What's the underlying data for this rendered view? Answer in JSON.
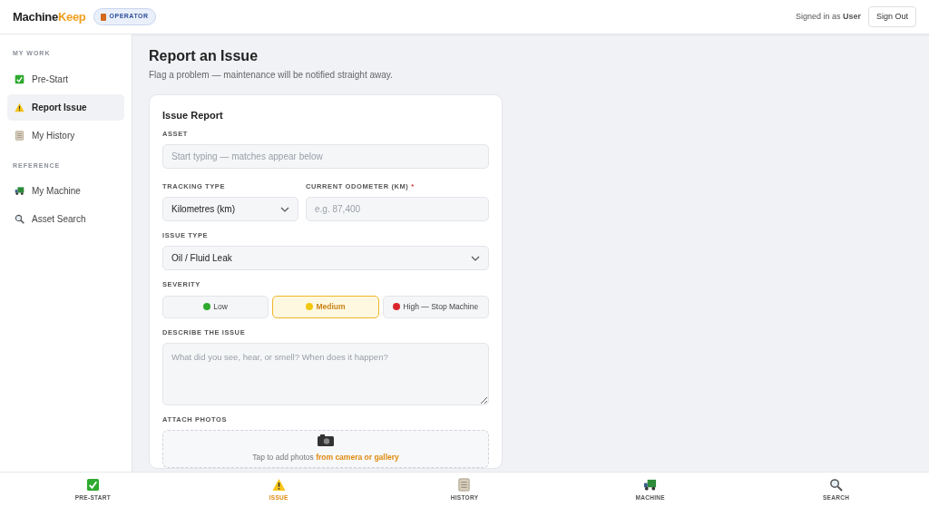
{
  "brand": {
    "part_1": "Machine",
    "part_2": "Keep"
  },
  "role_badge": "OPERATOR",
  "header": {
    "signed_in_prefix": "Signed in as",
    "user": "User",
    "sign_out": "Sign Out"
  },
  "sidebar": {
    "sections": [
      {
        "title": "MY WORK",
        "items": [
          {
            "label": "Pre-Start",
            "selected": false
          },
          {
            "label": "Report Issue",
            "selected": true
          },
          {
            "label": "My History",
            "selected": false
          }
        ]
      },
      {
        "title": "REFERENCE",
        "items": [
          {
            "label": "My Machine",
            "selected": false
          },
          {
            "label": "Asset Search",
            "selected": false
          }
        ]
      }
    ]
  },
  "page": {
    "title": "Report an Issue",
    "subtitle": "Flag a problem — maintenance will be notified straight away."
  },
  "form": {
    "title": "Issue Report",
    "asset": {
      "label": "ASSET",
      "placeholder": "Start typing — matches appear below"
    },
    "tracking_type": {
      "label": "TRACKING TYPE",
      "value": "Kilometres (km)"
    },
    "odometer": {
      "label": "CURRENT ODOMETER (KM)",
      "required_mark": "*",
      "placeholder": "e.g. 87,400"
    },
    "issue_type": {
      "label": "ISSUE TYPE",
      "value": "Oil / Fluid Leak"
    },
    "severity": {
      "label": "SEVERITY",
      "options": [
        {
          "label": "Low",
          "color": "#2eaa2e",
          "selected": false
        },
        {
          "label": "Medium",
          "color": "#f2c80f",
          "selected": true
        },
        {
          "label": "High — Stop Machine",
          "color": "#d9262c",
          "selected": false
        }
      ]
    },
    "description": {
      "label": "DESCRIBE THE ISSUE",
      "placeholder": "What did you see, hear, or smell? When does it happen?"
    },
    "photos": {
      "label": "ATTACH PHOTOS",
      "hint": "Tap to add photos",
      "link": "from camera or gallery"
    }
  },
  "bottom_nav": [
    {
      "label": "PRE-START",
      "selected": false
    },
    {
      "label": "ISSUE",
      "selected": true
    },
    {
      "label": "HISTORY",
      "selected": false
    },
    {
      "label": "MACHINE",
      "selected": false
    },
    {
      "label": "SEARCH",
      "selected": false
    }
  ]
}
